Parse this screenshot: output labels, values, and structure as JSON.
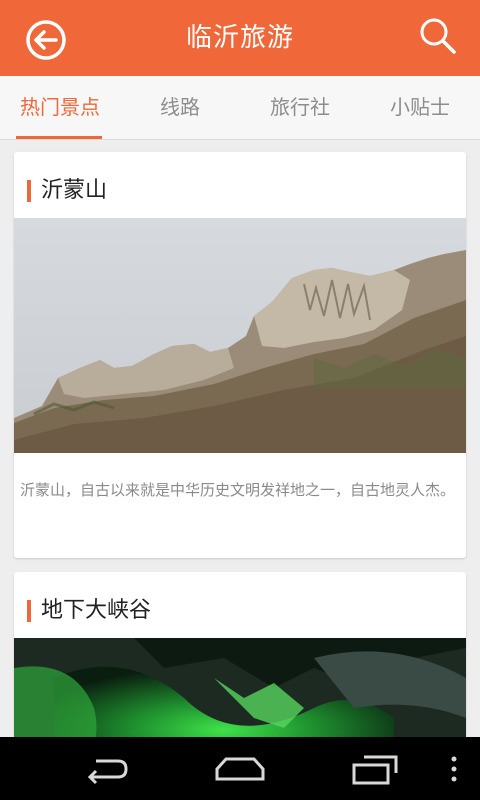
{
  "header": {
    "title": "临沂旅游",
    "back_icon": "back-circle-arrow-icon",
    "search_icon": "search-icon"
  },
  "tabs": [
    {
      "label": "热门景点",
      "active": true
    },
    {
      "label": "线路",
      "active": false
    },
    {
      "label": "旅行社",
      "active": false
    },
    {
      "label": "小贴士",
      "active": false
    }
  ],
  "spots": [
    {
      "name": "沂蒙山",
      "description": "沂蒙山，自古以来就是中华历史文明发祥地之一，自古地灵人杰。"
    },
    {
      "name": "地下大峡谷",
      "description": ""
    }
  ],
  "navbar": {
    "icons": [
      "back-icon",
      "home-icon",
      "recent-apps-icon",
      "menu-icon"
    ]
  },
  "colors": {
    "accent": "#f0683a",
    "tab_inactive": "#8d8d8d",
    "background": "#eeeeee"
  }
}
